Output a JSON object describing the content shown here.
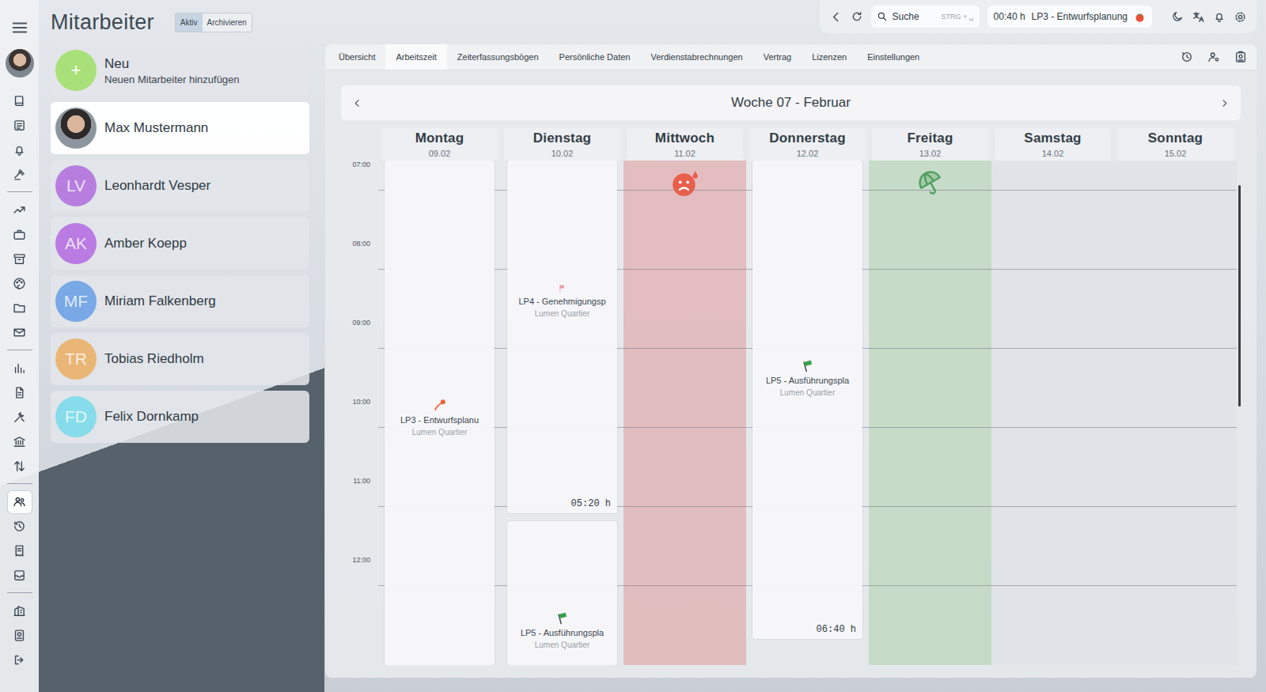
{
  "rail": {
    "items": [
      {
        "selected": false
      },
      {
        "selected": false
      },
      {
        "selected": false
      },
      {
        "selected": false
      },
      {
        "selected": false
      },
      {
        "selected": false
      },
      {
        "selected": false
      },
      {
        "selected": false
      },
      {
        "selected": false
      },
      {
        "selected": false
      },
      {
        "selected": false
      },
      {
        "selected": false
      },
      {
        "selected": false
      },
      {
        "selected": false
      },
      {
        "selected": false
      },
      {
        "selected": true
      },
      {
        "selected": false
      },
      {
        "selected": false
      },
      {
        "selected": false
      },
      {
        "selected": false
      },
      {
        "selected": false
      },
      {
        "selected": false
      }
    ]
  },
  "page": {
    "title": "Mitarbeiter",
    "filters": [
      {
        "label": "Aktiv",
        "selected": true
      },
      {
        "label": "Archivieren",
        "selected": false
      }
    ]
  },
  "new_card": {
    "icon": "+",
    "title": "Neu",
    "subtitle": "Neuen Mitarbeiter hinzufügen"
  },
  "employees": [
    {
      "name": "Max Mustermann",
      "kind": "photo",
      "selected": true
    },
    {
      "name": "Leonhardt Vesper",
      "kind": "initials",
      "initials": "LV",
      "color": "#b77ee0",
      "selected": false
    },
    {
      "name": "Amber Koepp",
      "kind": "initials",
      "initials": "AK",
      "color": "#ba7be3",
      "selected": false
    },
    {
      "name": "Miriam Falkenberg",
      "kind": "initials",
      "initials": "MF",
      "color": "#78a8e6",
      "selected": false
    },
    {
      "name": "Tobias Riedholm",
      "kind": "initials",
      "initials": "TR",
      "color": "#eab676",
      "selected": false
    },
    {
      "name": "Felix Dornkamp",
      "kind": "initials",
      "initials": "FD",
      "color": "#86dcea",
      "selected": false
    }
  ],
  "toolbar": {
    "search": {
      "placeholder": "Suche",
      "shortcut": "STRG + ␣"
    },
    "timer": {
      "time": "00:40 h",
      "task": "LP3 - Entwurfsplanung"
    }
  },
  "tabs": [
    {
      "label": "Übersicht",
      "selected": false
    },
    {
      "label": "Arbeitszeit",
      "selected": true
    },
    {
      "label": "Zeiterfassungsbögen",
      "selected": false
    },
    {
      "label": "Persönliche Daten",
      "selected": false
    },
    {
      "label": "Verdienstabrechnungen",
      "selected": false
    },
    {
      "label": "Vertrag",
      "selected": false
    },
    {
      "label": "Lizenzen",
      "selected": false
    },
    {
      "label": "Einstellungen",
      "selected": false
    }
  ],
  "week": {
    "title": "Woche 07 - Februar"
  },
  "calendar": {
    "hours": [
      "07:00",
      "08:00",
      "09:00",
      "10:00",
      "11:00",
      "12:00"
    ],
    "days": [
      {
        "name": "Montag",
        "date": "09.02",
        "kind": "work",
        "entries": [
          {
            "title": "LP3 - Entwurfsplanu",
            "project": "Lumen Quartier",
            "kind": "design",
            "color": "#e8643c"
          }
        ]
      },
      {
        "name": "Dienstag",
        "date": "10.02",
        "kind": "work",
        "entries": [
          {
            "title": "LP4 - Genehmigungsp",
            "project": "Lumen Quartier",
            "duration": "05:20 h",
            "kind": "permit",
            "color": "#e89aa2"
          },
          {
            "title": "LP5 - Ausführungspla",
            "project": "Lumen Quartier",
            "kind": "execution",
            "color": "#3aa14a"
          }
        ]
      },
      {
        "name": "Mittwoch",
        "date": "11.02",
        "kind": "sick",
        "entries": []
      },
      {
        "name": "Donnerstag",
        "date": "12.02",
        "kind": "work",
        "entries": [
          {
            "title": "LP5 - Ausführungspla",
            "project": "Lumen Quartier",
            "duration": "06:40 h",
            "kind": "execution",
            "color": "#3aa14a"
          }
        ]
      },
      {
        "name": "Freitag",
        "date": "13.02",
        "kind": "vacation",
        "entries": []
      },
      {
        "name": "Samstag",
        "date": "14.02",
        "kind": "free",
        "entries": []
      },
      {
        "name": "Sonntag",
        "date": "15.02",
        "kind": "free",
        "entries": []
      }
    ]
  }
}
